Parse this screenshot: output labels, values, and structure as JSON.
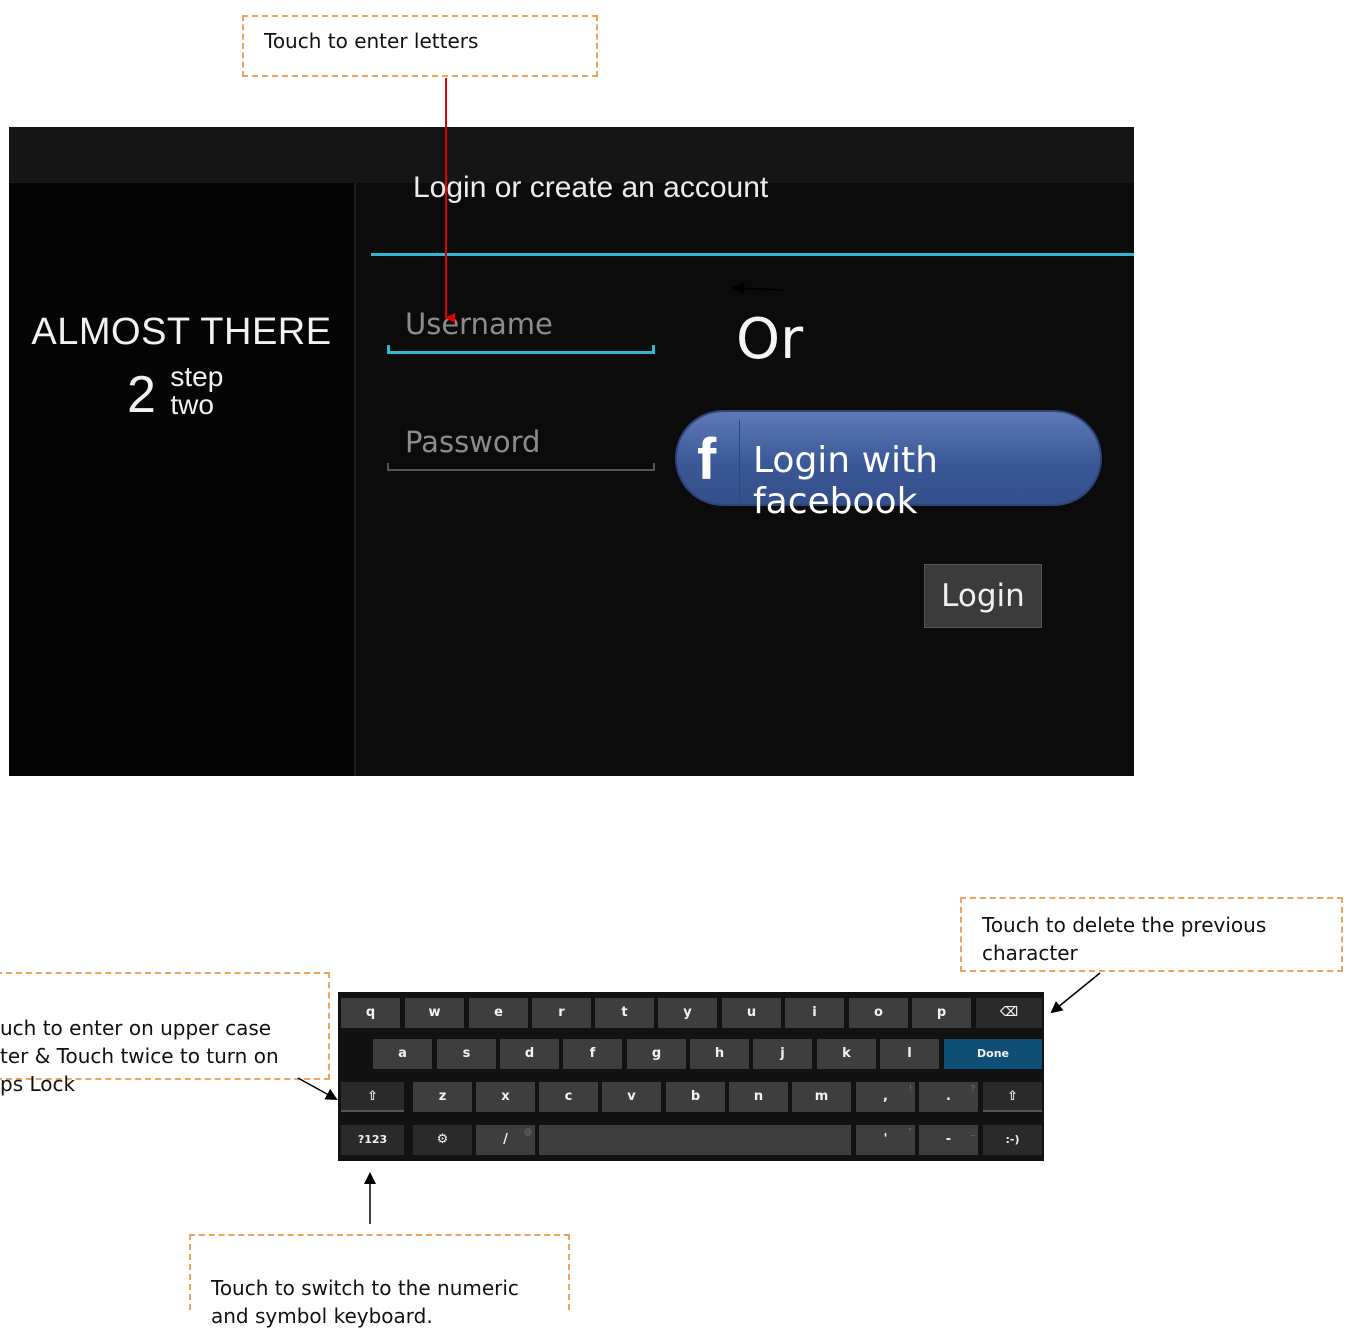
{
  "callouts": {
    "letters": "Touch to enter letters",
    "delete": "Touch to delete the previous character",
    "shift": "uch to enter on upper case\nter & Touch twice to turn on\nps Lock",
    "numeric": "Touch to switch to the numeric\nand symbol keyboard."
  },
  "screen": {
    "title": "Login or create an account",
    "left_heading": "ALMOST THERE",
    "step_number": "2",
    "step_word_1": "step",
    "step_word_2": "two",
    "username_placeholder": "Username",
    "password_placeholder": "Password",
    "or_text": "Or",
    "facebook_button": "Login with facebook",
    "facebook_icon": "f",
    "login_button": "Login"
  },
  "keyboard": {
    "row1": [
      "q",
      "w",
      "e",
      "r",
      "t",
      "y",
      "u",
      "i",
      "o",
      "p"
    ],
    "row2": [
      "a",
      "s",
      "d",
      "f",
      "g",
      "h",
      "j",
      "k",
      "l"
    ],
    "row3": [
      "z",
      "x",
      "c",
      "v",
      "b",
      "n",
      "m"
    ],
    "done": "Done",
    "comma": ",",
    "comma_alt": "!",
    "period": ".",
    "period_alt": "?",
    "numeric": "?123",
    "slash": "/",
    "slash_alt": "@",
    "apostrophe": "'",
    "apostrophe_alt": "\"",
    "dash": "-",
    "dash_alt": "_",
    "smiley": ":-)",
    "settings_glyph": "⚙",
    "shift_glyph": "⇧",
    "backspace_glyph": "⌫",
    "settings_icon": "settings-icon",
    "shift_icon": "shift-icon",
    "backspace_icon": "backspace-icon"
  },
  "colors": {
    "accent": "#2fb8d3",
    "facebook": "#3b5998",
    "callout_border": "#f0a35a",
    "arrow_red": "#e00000",
    "done_key": "#0f4f75"
  }
}
